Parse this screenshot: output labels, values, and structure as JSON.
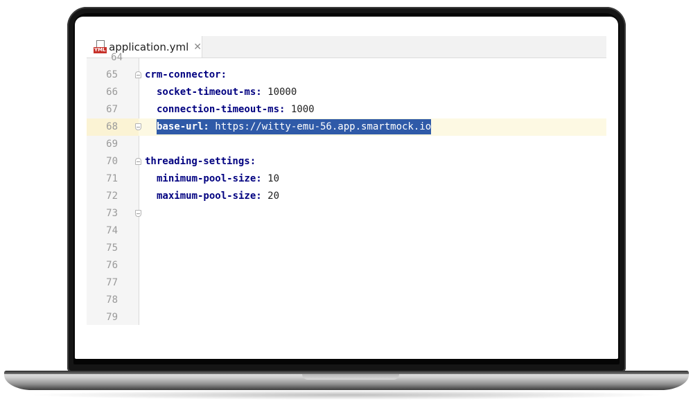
{
  "tab": {
    "file_name": "application.yml",
    "icon_badge": "YML",
    "close_glyph": "✕"
  },
  "editor": {
    "partial_line": "64",
    "lines": [
      {
        "num": "65",
        "key": "crm-connector:",
        "value": ""
      },
      {
        "num": "66",
        "key": "socket-timeout-ms:",
        "value": " 10000"
      },
      {
        "num": "67",
        "key": "connection-timeout-ms:",
        "value": " 1000"
      },
      {
        "num": "68",
        "key": "base-url:",
        "value": " https://witty-emu-56.app.smartmock.io"
      },
      {
        "num": "69",
        "key": "",
        "value": ""
      },
      {
        "num": "70",
        "key": "threading-settings:",
        "value": ""
      },
      {
        "num": "71",
        "key": "minimum-pool-size:",
        "value": " 10"
      },
      {
        "num": "72",
        "key": "maximum-pool-size:",
        "value": " 20"
      },
      {
        "num": "73",
        "key": "",
        "value": ""
      },
      {
        "num": "74",
        "key": "",
        "value": ""
      },
      {
        "num": "75",
        "key": "",
        "value": ""
      },
      {
        "num": "76",
        "key": "",
        "value": ""
      },
      {
        "num": "77",
        "key": "",
        "value": ""
      },
      {
        "num": "78",
        "key": "",
        "value": ""
      },
      {
        "num": "79",
        "key": "",
        "value": ""
      }
    ]
  },
  "colors": {
    "key": "#000080",
    "selection": "#2f5aa8",
    "current_line": "#fdf9e3"
  },
  "icons": [
    "yml-file-icon",
    "close-icon",
    "fold-marker-icon"
  ]
}
